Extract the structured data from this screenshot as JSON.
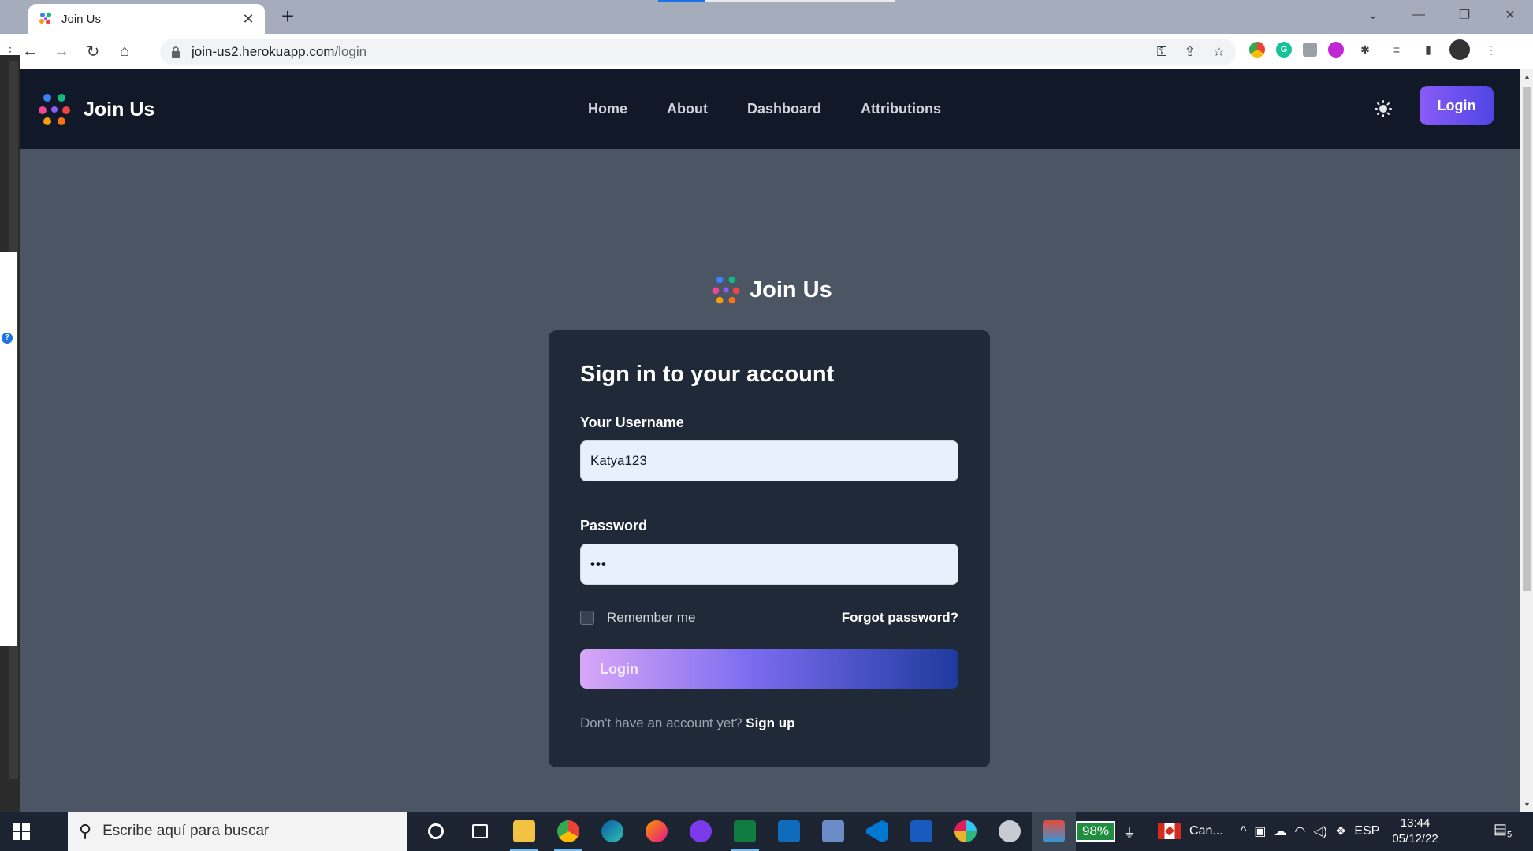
{
  "browser": {
    "tab_title": "Join Us",
    "tab_close": "✕",
    "new_tab": "+",
    "url_host": "join-us2.herokuapp.com",
    "url_path": "/login",
    "window_controls": [
      "⌄",
      "—",
      "❐",
      "✕"
    ]
  },
  "site": {
    "brand_name": "Join Us",
    "nav": [
      "Home",
      "About",
      "Dashboard",
      "Attributions"
    ],
    "nav_login": "Login"
  },
  "login_form": {
    "brand_name": "Join Us",
    "heading": "Sign in to your account",
    "username_label": "Your Username",
    "username_value": "Katya123",
    "password_label": "Password",
    "password_value": "•••",
    "remember_label": "Remember me",
    "remember_checked": false,
    "forgot_label": "Forgot password?",
    "submit_label": "Login",
    "signup_prompt": "Don't have an account yet?",
    "signup_link": "Sign up"
  },
  "taskbar": {
    "search_placeholder": "Escribe aquí para buscar",
    "battery": "98%",
    "region": "Can...",
    "language": "ESP",
    "time": "13:44",
    "date": "05/12/22",
    "notifications": "5"
  },
  "colors": {
    "page_bg": "#4b5563",
    "navbar_bg": "#111827",
    "card_bg": "#1f2937",
    "accent_start": "#8b5cf6",
    "accent_end": "#1e3a9e"
  }
}
